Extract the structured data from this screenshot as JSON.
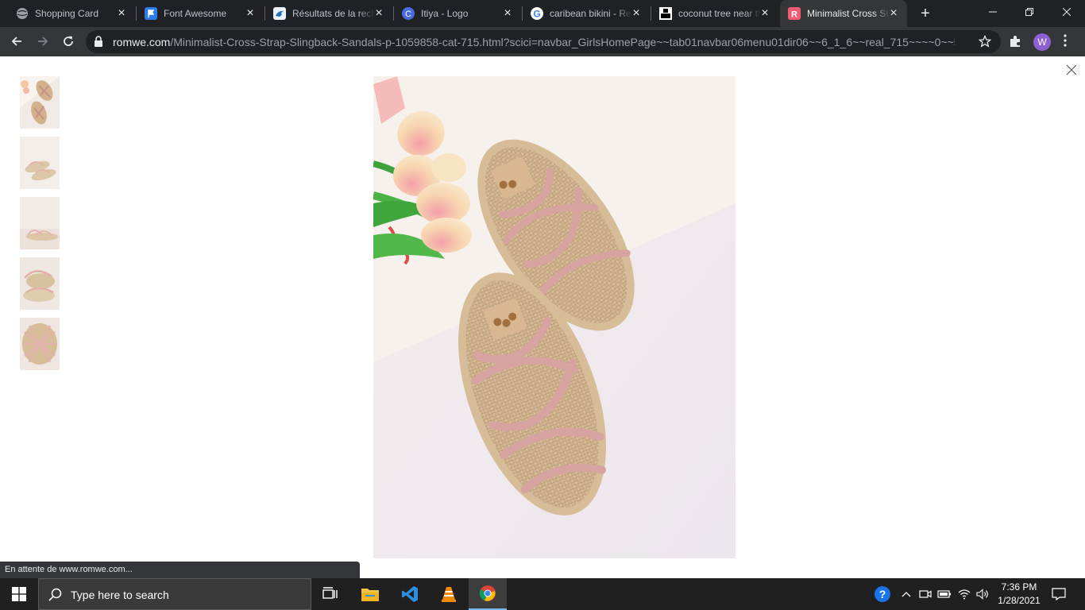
{
  "browser": {
    "tabs": [
      {
        "title": "Shopping Card",
        "favicon": "globe-icon",
        "active": false
      },
      {
        "title": "Font Awesome",
        "favicon": "flag-icon",
        "active": false
      },
      {
        "title": "Résultats de la recherche",
        "favicon": "bird-icon",
        "active": false
      },
      {
        "title": "Itiya - Logo",
        "favicon": "c-logo-icon",
        "active": false
      },
      {
        "title": "caribean bikini - Recherche Google",
        "favicon": "google-icon",
        "active": false
      },
      {
        "title": "coconut tree near the beach",
        "favicon": "unsplash-icon",
        "active": false
      },
      {
        "title": "Minimalist Cross Strap Slingback Sandals",
        "favicon": "romwe-icon",
        "active": true
      }
    ],
    "url_host": "romwe.com",
    "url_path": "/Minimalist-Cross-Strap-Slingback-Sandals-p-1059858-cat-715.html?scici=navbar_GirlsHomePage~~tab01navbar06menu01dir06~~6_1_6~~real_715~~~~0~~5...",
    "profile_initial": "W",
    "status_text": "En attente de www.romwe.com..."
  },
  "gallery": {
    "thumbnails": [
      "thumb-1",
      "thumb-2",
      "thumb-3",
      "thumb-4",
      "thumb-5"
    ],
    "main_image": "sandals-product-photo"
  },
  "taskbar": {
    "search_placeholder": "Type here to search",
    "time": "7:36 PM",
    "date": "1/28/2021"
  },
  "colors": {
    "tab_strip": "#202124",
    "toolbar": "#35363a",
    "taskbar": "#202020",
    "accent": "#8e5fd1"
  }
}
